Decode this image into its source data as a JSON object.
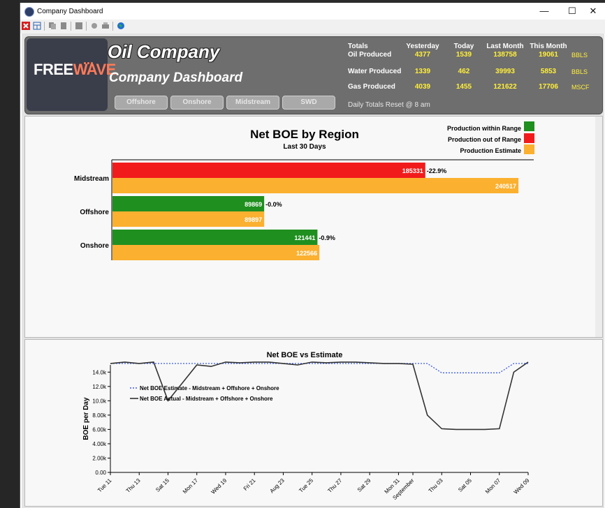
{
  "window": {
    "title": "Company Dashboard",
    "controls": {
      "minimize": "—",
      "maximize": "☐",
      "close": "✕"
    }
  },
  "toolbar": {
    "icons": [
      "close-red-icon",
      "layout-icon",
      "copy-icon",
      "paste-icon",
      "save-icon",
      "settings-icon",
      "print-icon",
      "globe-icon"
    ]
  },
  "header": {
    "logo": {
      "text_main": "FREE",
      "text_accent": "WAVE"
    },
    "company_title": "Oil Company",
    "dashboard_title": "Company Dashboard",
    "region_buttons": [
      "Offshore",
      "Onshore",
      "Midstream",
      "SWD"
    ],
    "totals": {
      "heading": "Totals",
      "columns": [
        "Yesterday",
        "Today",
        "Last Month",
        "This Month"
      ],
      "rows": [
        {
          "label": "Oil Produced",
          "values": [
            "4377",
            "1539",
            "138758",
            "19061"
          ],
          "unit": "BBLS"
        },
        {
          "label": "Water Produced",
          "values": [
            "1339",
            "462",
            "39993",
            "5853"
          ],
          "unit": "BBLS"
        },
        {
          "label": "Gas Produced",
          "values": [
            "4039",
            "1455",
            "121622",
            "17706"
          ],
          "unit": "MSCF"
        }
      ],
      "reset_note": "Daily Totals Reset @ 8 am"
    }
  },
  "colors": {
    "within_range": "#1f8f1f",
    "out_of_range": "#f21b1b",
    "estimate": "#fbb030",
    "values": "#ffef3a"
  },
  "chart_data": [
    {
      "type": "bar",
      "orientation": "horizontal",
      "title": "Net BOE by Region",
      "subtitle": "Last 30 Days",
      "legend": [
        "Production within Range",
        "Production out of Range",
        "Production Estimate"
      ],
      "legend_position": "top-right",
      "categories": [
        "Midstream",
        "Offshore",
        "Onshore"
      ],
      "actual": [
        {
          "value": 185331,
          "label": "185331",
          "status": "out",
          "diff": "-22.9%"
        },
        {
          "value": 89869,
          "label": "89869",
          "status": "within",
          "diff": "-0.0%"
        },
        {
          "value": 121441,
          "label": "121441",
          "status": "within",
          "diff": "-0.9%"
        }
      ],
      "estimate": [
        240517,
        89897,
        122566
      ],
      "xlim": [
        0,
        250000
      ]
    },
    {
      "type": "line",
      "title": "Net BOE vs Estimate",
      "ylabel": "BOE per Day",
      "ylim": [
        0,
        15000
      ],
      "yticks": [
        "0.00",
        "2.00k",
        "4.00k",
        "6.00k",
        "8.00k",
        "10.0k",
        "12.0k",
        "14.0k"
      ],
      "ytick_values": [
        0,
        2000,
        4000,
        6000,
        8000,
        10000,
        12000,
        14000
      ],
      "xticks": [
        "Tue 11",
        "Thu 13",
        "Sat 15",
        "Mon 17",
        "Wed 19",
        "Fri 21",
        "Aug 23",
        "Tue 25",
        "Thu 27",
        "Sat 29",
        "Mon 31",
        "September",
        "Thu 03",
        "Sat 05",
        "Mon 07",
        "Wed 09"
      ],
      "xtick_days": [
        0,
        2,
        4,
        6,
        8,
        10,
        12,
        14,
        16,
        18,
        20,
        21,
        23,
        25,
        27,
        29
      ],
      "series": [
        {
          "name": "Net BOE Estimate - Midstream + Offshore + Onshore",
          "style": "dotted",
          "color": "#3d5ee8",
          "days": [
            0,
            1,
            2,
            3,
            4,
            5,
            6,
            7,
            8,
            9,
            10,
            11,
            12,
            13,
            14,
            15,
            16,
            17,
            18,
            19,
            20,
            21,
            22,
            23,
            24,
            25,
            26,
            27,
            28,
            29
          ],
          "values": [
            15200,
            15200,
            15200,
            15200,
            15200,
            15200,
            15200,
            15200,
            15200,
            15200,
            15200,
            15200,
            15200,
            15200,
            15200,
            15200,
            15200,
            15200,
            15200,
            15200,
            15200,
            15200,
            15200,
            13900,
            13900,
            13900,
            13900,
            13900,
            15200,
            15200
          ]
        },
        {
          "name": "Net BOE Actual - Midstream + Offshore + Onshore",
          "style": "solid",
          "color": "#333333",
          "days": [
            0,
            1,
            2,
            3,
            4,
            5,
            6,
            7,
            8,
            9,
            10,
            11,
            12,
            13,
            14,
            15,
            16,
            17,
            18,
            19,
            20,
            21,
            22,
            23,
            24,
            25,
            26,
            27,
            28,
            29
          ],
          "values": [
            15200,
            15400,
            15200,
            15400,
            10000,
            12500,
            15000,
            14800,
            15400,
            15300,
            15400,
            15400,
            15200,
            15000,
            15400,
            15300,
            15400,
            15400,
            15300,
            15200,
            15200,
            15100,
            8000,
            6100,
            6000,
            6000,
            6000,
            6100,
            14000,
            15400
          ]
        }
      ],
      "legend_position": "top-left"
    }
  ]
}
